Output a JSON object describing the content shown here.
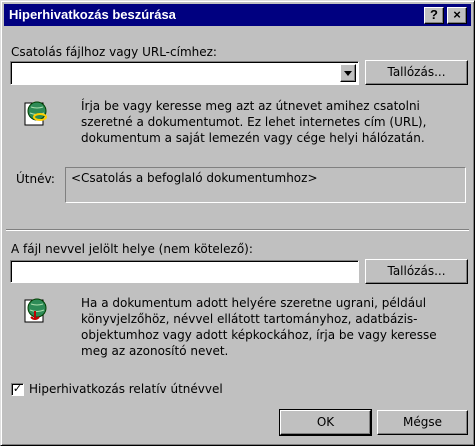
{
  "window": {
    "title": "Hiperhivatkozás beszúrása",
    "help_label": "?",
    "close_label": "×"
  },
  "link_target": {
    "label": "Csatolás fájlhoz vagy URL-címhez:",
    "value": "",
    "browse_label": "Tallózás...",
    "description": "Írja be vagy keresse meg azt az útnevet amihez csatolni szeretné a dokumentumot. Ez lehet internetes cím (URL), dokumentum a saját lemezén vagy cége helyi hálózatán.",
    "path_label": "Útnév:",
    "path_value": "<Csatolás a befoglaló dokumentumhoz>"
  },
  "named_location": {
    "label": "A fájl nevvel jelölt helye (nem kötelező):",
    "value": "",
    "browse_label": "Tallózás...",
    "description": "Ha a dokumentum adott helyére szeretne ugrani, például könyvjelzőhöz, névvel ellátott tartományhoz, adatbázis-objektumhoz vagy adott képkockához, írja be vagy keresse meg az azonosító nevet."
  },
  "relative_path": {
    "label": "Hiperhivatkozás relatív útnévvel",
    "checked": true,
    "check_glyph": "✓"
  },
  "buttons": {
    "ok": "OK",
    "cancel": "Mégse"
  },
  "icons": {
    "globe_link": "globe-link-icon",
    "globe_anchor": "globe-anchor-icon"
  }
}
